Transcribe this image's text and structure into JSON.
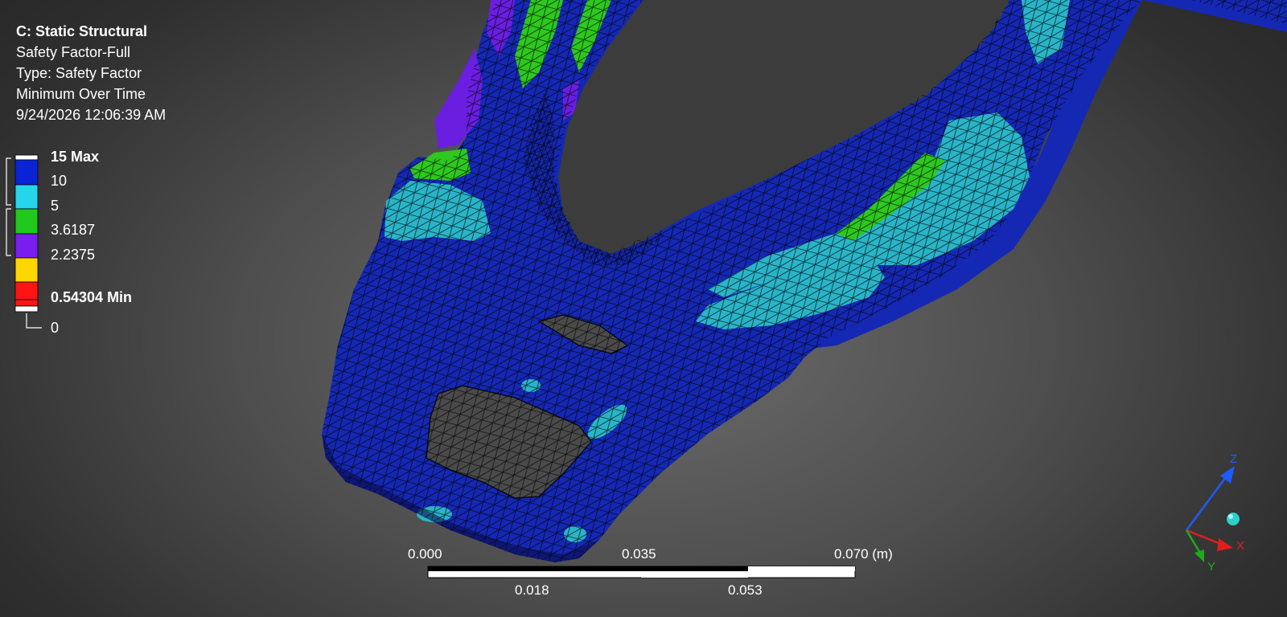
{
  "header": {
    "title": "C: Static Structural",
    "line1": "Safety Factor-Full",
    "line2": "Type: Safety Factor",
    "line3": "Minimum Over Time",
    "line4": "9/24/2026 12:06:39 AM"
  },
  "legend": {
    "labels": [
      "15 Max",
      "10",
      "5",
      "3.6187",
      "2.2375",
      "0.54304 Min",
      "0"
    ],
    "colors": [
      "#0a23d6",
      "#25d5ec",
      "#21c81e",
      "#7a1ef0",
      "#ffd600",
      "#ff1414",
      "#ffffff"
    ]
  },
  "scale": {
    "top_labels": [
      "0.000",
      "0.035",
      "0.070 (m)"
    ],
    "bottom_labels": [
      "0.018",
      "0.053"
    ]
  },
  "triad": {
    "z": "Z",
    "x": "X",
    "y": "Y",
    "z_color": "#1f5bff",
    "x_color": "#e01e1e",
    "y_color": "#1eaa1e",
    "ball_color": "#2ecfc8"
  },
  "mesh_colors": {
    "blue": "#1528b4",
    "cyan": "#2ab4c8",
    "green": "#2ec81e",
    "purple": "#6a1ee0"
  }
}
